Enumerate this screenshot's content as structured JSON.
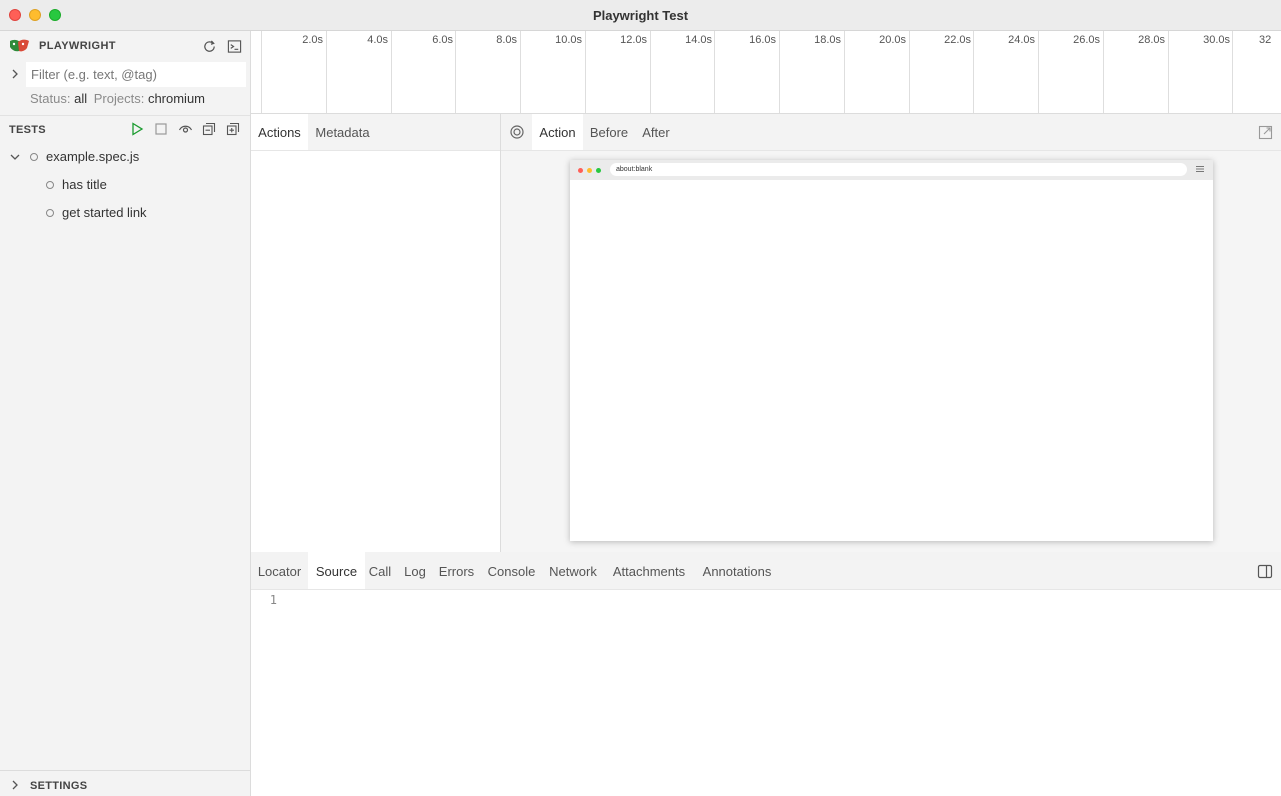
{
  "window": {
    "title": "Playwright Test"
  },
  "sidebar": {
    "brand": "PLAYWRIGHT",
    "filter_placeholder": "Filter (e.g. text, @tag)",
    "status_label": "Status:",
    "status_value": "all",
    "projects_label": "Projects:",
    "projects_value": "chromium",
    "tests_title": "TESTS",
    "tree": {
      "file": "example.spec.js",
      "tests": [
        "has title",
        "get started link"
      ]
    },
    "settings_title": "SETTINGS"
  },
  "timeline": {
    "ticks": [
      "2.0s",
      "4.0s",
      "6.0s",
      "8.0s",
      "10.0s",
      "12.0s",
      "14.0s",
      "16.0s",
      "18.0s",
      "20.0s",
      "22.0s",
      "24.0s",
      "26.0s",
      "28.0s",
      "30.0s",
      "32"
    ]
  },
  "action_list": {
    "tabs": [
      "Actions",
      "Metadata"
    ],
    "selected_tab": "Actions"
  },
  "snapshot": {
    "tabs": [
      "Action",
      "Before",
      "After"
    ],
    "selected_tab": "Action",
    "url": "about:blank"
  },
  "bottom": {
    "tabs": [
      "Locator",
      "Source",
      "Call",
      "Log",
      "Errors",
      "Console",
      "Network",
      "Attachments",
      "Annotations"
    ],
    "selected_tab": "Source",
    "line_number": "1"
  },
  "icons": {
    "logo": "playwright-logo",
    "reload": "reload-icon",
    "terminal": "terminal-icon",
    "run": "run-icon",
    "stop": "stop-icon",
    "watch": "eye-icon",
    "collapse": "collapse-all-icon",
    "expand": "expand-all-icon",
    "pick_locator": "target-icon",
    "open_external": "open-external-icon",
    "toggle_sidebar": "sidebar-toggle-icon"
  },
  "colors": {
    "run_green": "#1a9b2f",
    "close": "#ff5f57",
    "minimize": "#febc2e",
    "maximize": "#28c840"
  }
}
